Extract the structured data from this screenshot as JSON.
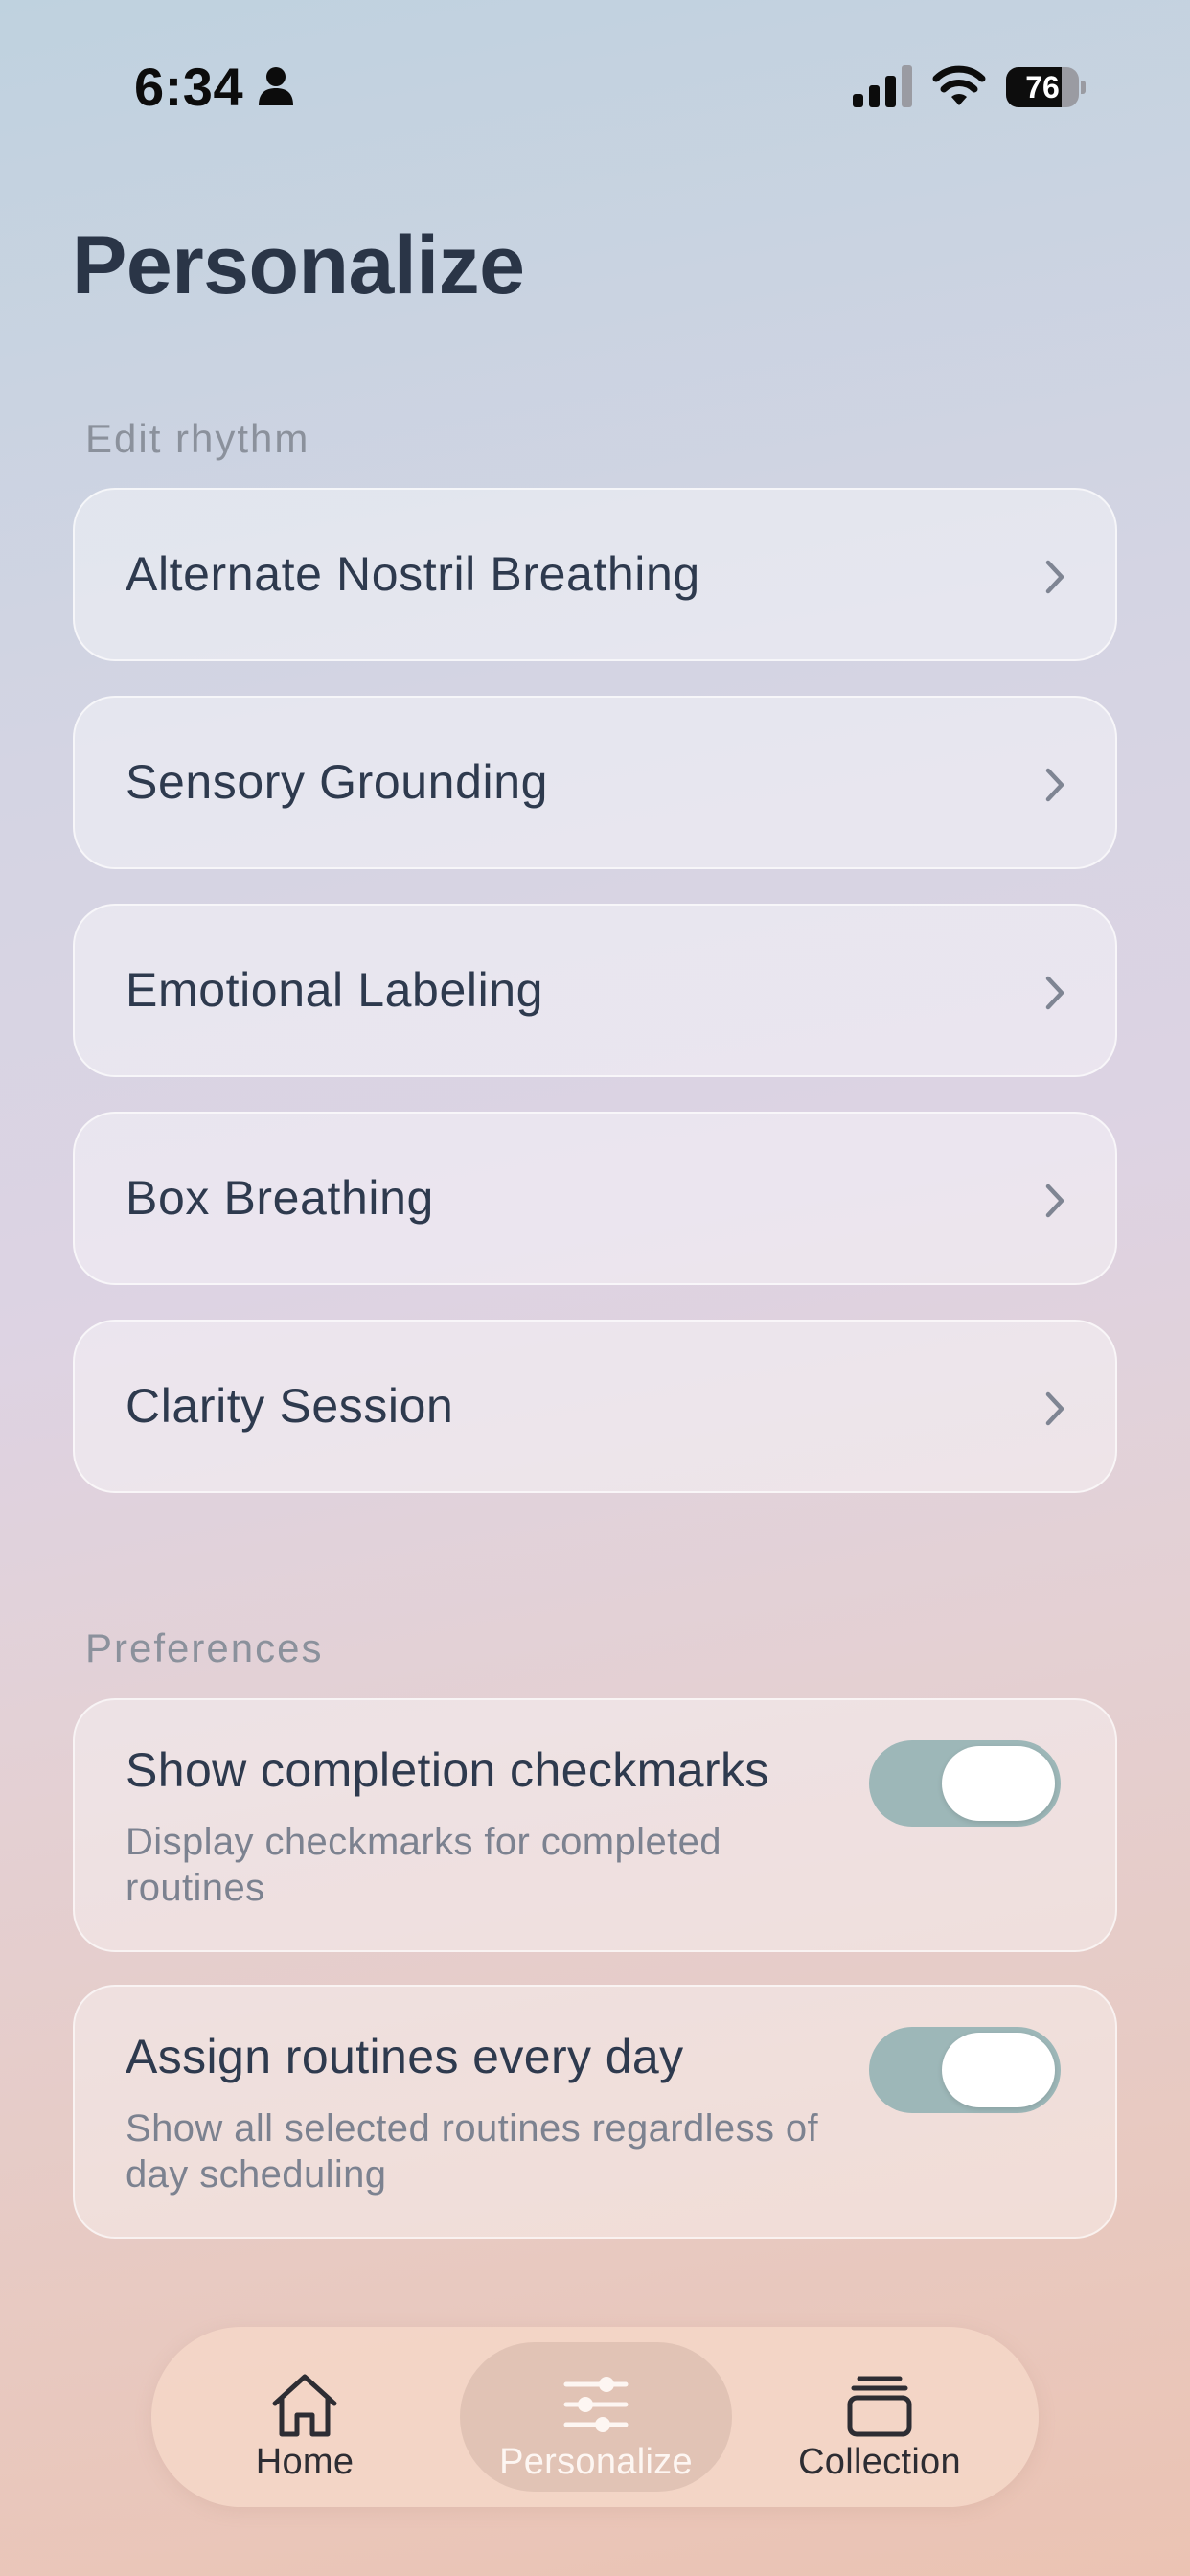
{
  "status_bar": {
    "time": "6:34",
    "battery_level": "76",
    "battery_fraction": 0.76
  },
  "title": "Personalize",
  "edit_section": {
    "label": "Edit rhythm",
    "items": [
      {
        "label": "Alternate Nostril Breathing",
        "icon": "chevron-right-icon"
      },
      {
        "label": "Sensory Grounding",
        "icon": "chevron-right-icon"
      },
      {
        "label": "Emotional Labeling",
        "icon": "chevron-right-icon"
      },
      {
        "label": "Box Breathing",
        "icon": "chevron-right-icon"
      },
      {
        "label": "Clarity Session",
        "icon": "chevron-right-icon"
      }
    ]
  },
  "preferences": {
    "label": "Preferences",
    "items": [
      {
        "title": "Show completion checkmarks",
        "description": "Display checkmarks for completed routines",
        "enabled": true
      },
      {
        "title": "Assign routines every day",
        "description": "Show all selected routines regardless of day scheduling",
        "enabled": true
      }
    ]
  },
  "tab_bar": {
    "active": "Personalize",
    "tabs": [
      {
        "label": "Home",
        "icon": "home-icon"
      },
      {
        "label": "Personalize",
        "icon": "sliders-icon"
      },
      {
        "label": "Collection",
        "icon": "stack-icon"
      }
    ]
  },
  "colors": {
    "title_text": "#2a3547",
    "toggle_on": "#9db7b8",
    "secondary_text": "#7c8290"
  }
}
